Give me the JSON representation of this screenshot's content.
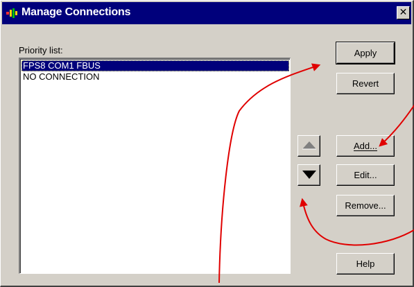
{
  "window": {
    "title": "Manage Connections",
    "close_glyph": "✕"
  },
  "priority_list": {
    "label": "Priority list:",
    "items": [
      "FPS8 COM1 FBUS",
      "NO CONNECTION"
    ],
    "selected_index": 0
  },
  "buttons": {
    "apply": "Apply",
    "revert": "Revert",
    "add": "Add...",
    "edit": "Edit...",
    "remove": "Remove...",
    "help": "Help"
  },
  "arrows": {
    "up_enabled": false,
    "down_enabled": true
  },
  "annotation": {
    "arrow_color": "#e00000"
  },
  "colors": {
    "titlebar": "#00007b",
    "face": "#d4d0c8",
    "selection": "#00007b"
  }
}
